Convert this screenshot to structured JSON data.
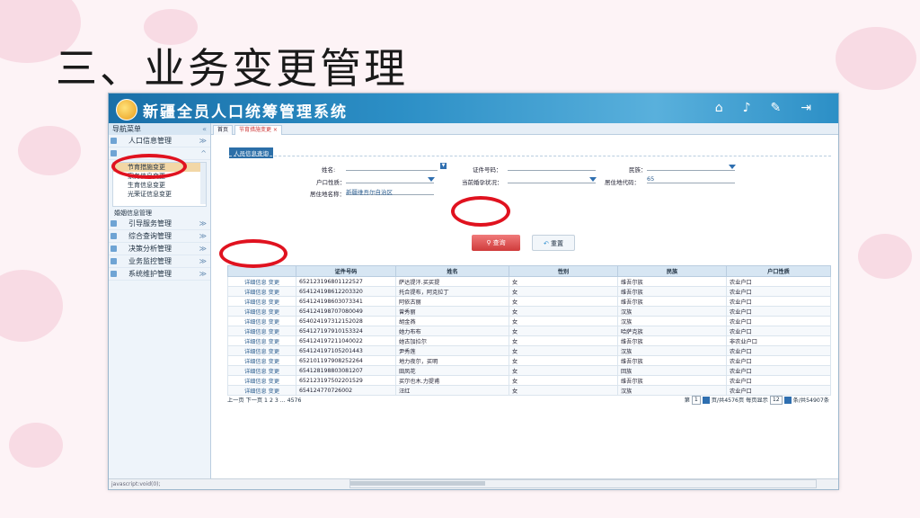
{
  "slide": {
    "title": "三、业务变更管理"
  },
  "app": {
    "title": "新疆全员人口统筹管理系统",
    "top_icons": [
      "home-icon",
      "bell-icon",
      "tools-icon",
      "logout-icon"
    ]
  },
  "sidebar": {
    "header": "导航菜单",
    "groups": [
      {
        "label": "人口信息管理"
      },
      {
        "label": ""
      }
    ],
    "tree_items": [
      "节育措施变更",
      "家务信息变更",
      "生育信息变更",
      "光荣证信息变更",
      "婚姻信息管理"
    ],
    "groups_after": [
      {
        "label": "引导服务管理"
      },
      {
        "label": "综合查询管理"
      },
      {
        "label": "决策分析管理"
      },
      {
        "label": "业务监控管理"
      },
      {
        "label": "系统维护管理"
      }
    ]
  },
  "tabs": [
    {
      "label": "首页"
    },
    {
      "label": "节育措施变更 ×"
    }
  ],
  "form": {
    "section": "人员信息查询",
    "name_label": "姓名:",
    "id_label": "证件号码：",
    "ethnicity_label": "民族：",
    "hukou_label": "户口性质：",
    "marital_label": "当前婚孕状况：",
    "region_code_label": "居住地代码：",
    "region_code_value": "65",
    "region_name_label": "居住地名称：",
    "region_name_value": "新疆维吾尔自治区",
    "query_button": "查询",
    "reset_button": "重置"
  },
  "table": {
    "headers": [
      "",
      "证件号码",
      "姓名",
      "性别",
      "民族",
      "户口性质"
    ],
    "action_label": "详细信息  变更",
    "rows": [
      [
        "652123196801122527",
        "萨达提汗.买买提",
        "女",
        "维吾尔族",
        "农业户口"
      ],
      [
        "654124198612203320",
        "托合提布，阿克拉丁",
        "女",
        "维吾尔族",
        "农业户口"
      ],
      [
        "654124198603073341",
        "阿依古丽",
        "女",
        "维吾尔族",
        "农业户口"
      ],
      [
        "654124198707080049",
        "曾秀丽",
        "女",
        "汉族",
        "农业户口"
      ],
      [
        "654024197312152028",
        "胡金燕",
        "女",
        "汉族",
        "农业户口"
      ],
      [
        "654127197910153324",
        "她力布布",
        "女",
        "哈萨克族",
        "农业户口"
      ],
      [
        "654124197211040022",
        "她古加拉尔",
        "女",
        "维吾尔族",
        "非农业户口"
      ],
      [
        "654124197105201443",
        "尹秀莲",
        "女",
        "汉族",
        "农业户口"
      ],
      [
        "652101197908252264",
        "地力夜尔，买明",
        "女",
        "维吾尔族",
        "农业户口"
      ],
      [
        "654128198803081207",
        "田凤花",
        "女",
        "回族",
        "农业户口"
      ],
      [
        "652123197502201529",
        "买尔也木.力提甫",
        "女",
        "维吾尔族",
        "农业户口"
      ],
      [
        "654124770726002",
        "汪红",
        "女",
        "汉族",
        "农业户口"
      ]
    ]
  },
  "pager": {
    "left": "上一页  下一页    1  2  3  ...  4576",
    "page_prefix": "第",
    "page_value": "1",
    "page_suffix": "页/共4576页",
    "size_prefix": "每页显示",
    "size_value": "12",
    "size_suffix": "条/共54907条"
  },
  "status": "javascript:void(0);"
}
